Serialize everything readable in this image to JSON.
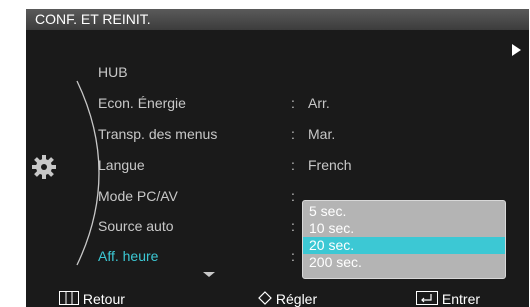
{
  "header": {
    "title": "CONF. ET REINIT."
  },
  "menu": [
    {
      "label": "HUB",
      "colon": "",
      "value": ""
    },
    {
      "label": "Econ. Énergie",
      "colon": ":",
      "value": "Arr."
    },
    {
      "label": "Transp. des menus",
      "colon": ":",
      "value": "Mar."
    },
    {
      "label": "Langue",
      "colon": ":",
      "value": "French"
    },
    {
      "label": "Mode PC/AV",
      "colon": ":",
      "value": ""
    },
    {
      "label": "Source auto",
      "colon": ":",
      "value": ""
    },
    {
      "label": "Aff. heure",
      "colon": ":",
      "value": ""
    }
  ],
  "active_item": "Aff. heure",
  "dropdown": {
    "options": [
      "5 sec.",
      "10 sec.",
      "20 sec.",
      "200 sec."
    ],
    "selected": "20 sec."
  },
  "footer": {
    "back_label": "Retour",
    "adjust_label": "Régler",
    "enter_label": "Entrer"
  },
  "colors": {
    "accent": "#3cc8d4",
    "background": "#1a1a1a",
    "text": "#c8c8c8",
    "dropdown_bg": "#b4b4b4"
  },
  "icons": [
    "play-icon",
    "gear-icon",
    "chevron-down-icon",
    "menu-icon",
    "adjust-icon",
    "enter-icon"
  ]
}
